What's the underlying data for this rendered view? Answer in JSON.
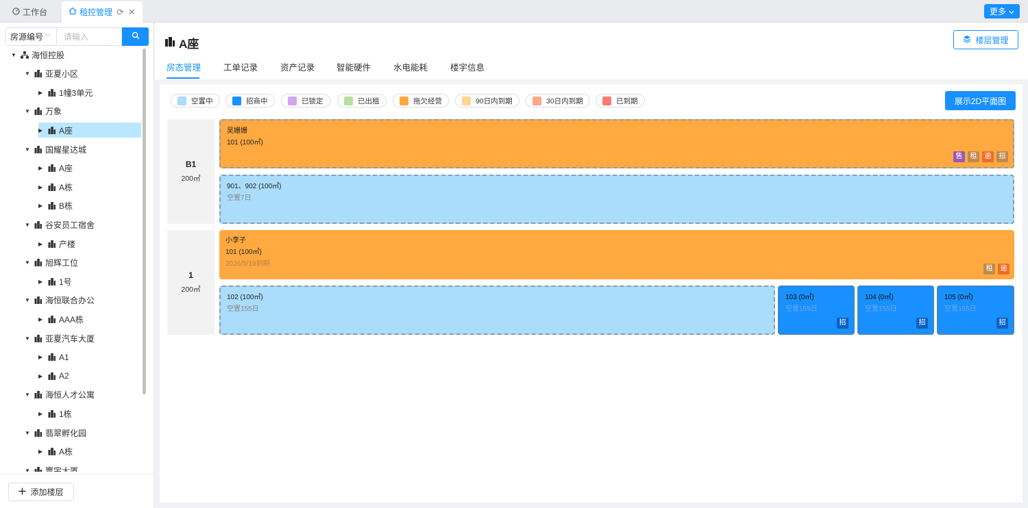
{
  "tabs_bar": {
    "workbench": "工作台",
    "rent_control": "租控管理",
    "more": "更多"
  },
  "sidebar": {
    "search_select": "房源编号",
    "search_placeholder": "请输入",
    "tree": [
      {
        "label": "海恒控股",
        "level": 0,
        "expanded": true,
        "icon": "org-icon"
      },
      {
        "label": "亚夏小区",
        "level": 1,
        "expanded": true,
        "icon": "building-icon"
      },
      {
        "label": "1幢3单元",
        "level": 2,
        "expanded": false,
        "icon": "building-icon"
      },
      {
        "label": "万象",
        "level": 1,
        "expanded": true,
        "icon": "building-icon"
      },
      {
        "label": "A座",
        "level": 2,
        "expanded": false,
        "icon": "building-icon",
        "selected": true
      },
      {
        "label": "国耀星达城",
        "level": 1,
        "expanded": true,
        "icon": "building-icon"
      },
      {
        "label": "A座",
        "level": 2,
        "expanded": false,
        "icon": "building-icon"
      },
      {
        "label": "A栋",
        "level": 2,
        "expanded": false,
        "icon": "building-icon"
      },
      {
        "label": "B栋",
        "level": 2,
        "expanded": false,
        "icon": "building-icon"
      },
      {
        "label": "谷安员工宿舍",
        "level": 1,
        "expanded": true,
        "icon": "building-icon"
      },
      {
        "label": "产楼",
        "level": 2,
        "expanded": false,
        "icon": "building-icon"
      },
      {
        "label": "旭辉工位",
        "level": 1,
        "expanded": true,
        "icon": "building-icon"
      },
      {
        "label": "1号",
        "level": 2,
        "expanded": false,
        "icon": "building-icon"
      },
      {
        "label": "海恒联合办公",
        "level": 1,
        "expanded": true,
        "icon": "building-icon"
      },
      {
        "label": "AAA栋",
        "level": 2,
        "expanded": false,
        "icon": "building-icon"
      },
      {
        "label": "亚夏汽车大厦",
        "level": 1,
        "expanded": true,
        "icon": "building-icon"
      },
      {
        "label": "A1",
        "level": 2,
        "expanded": false,
        "icon": "building-icon"
      },
      {
        "label": "A2",
        "level": 2,
        "expanded": false,
        "icon": "building-icon"
      },
      {
        "label": "海恒人才公寓",
        "level": 1,
        "expanded": true,
        "icon": "building-icon"
      },
      {
        "label": "1栋",
        "level": 2,
        "expanded": false,
        "icon": "building-icon"
      },
      {
        "label": "翡翠孵化园",
        "level": 1,
        "expanded": true,
        "icon": "building-icon"
      },
      {
        "label": "A栋",
        "level": 2,
        "expanded": false,
        "icon": "building-icon"
      },
      {
        "label": "寰宇大厦",
        "level": 1,
        "expanded": true,
        "icon": "building-icon"
      }
    ],
    "add_floor": "添加楼层"
  },
  "header": {
    "title": "A座",
    "floor_manage": "楼层管理",
    "tabs": [
      "房态管理",
      "工单记录",
      "资产记录",
      "智能硬件",
      "水电能耗",
      "楼宇信息"
    ]
  },
  "legend": [
    {
      "label": "空置中",
      "color": "#aadcfb"
    },
    {
      "label": "招商中",
      "color": "#1890ff"
    },
    {
      "label": "已锁定",
      "color": "#d3a4f0"
    },
    {
      "label": "已出租",
      "color": "#b7e0a0"
    },
    {
      "label": "拖欠经营",
      "color": "#ffa940"
    },
    {
      "label": "90日内到期",
      "color": "#ffd591"
    },
    {
      "label": "30日内到期",
      "color": "#ffa88a"
    },
    {
      "label": "已到期",
      "color": "#ff7875"
    }
  ],
  "show_2d": "展示2D平面图",
  "floors": [
    {
      "name": "B1",
      "area": "200㎡",
      "units": [
        {
          "line1": "吴姗姗",
          "line2": "101 (100㎡)",
          "line3": "",
          "badges": [
            "售",
            "租",
            "逾",
            "招"
          ]
        },
        {
          "line1": "901、902 (100㎡)",
          "line2": "空置7日",
          "badges": []
        }
      ]
    },
    {
      "name": "1",
      "area": "200㎡",
      "units": [
        {
          "line1": "小李子",
          "line2": "101 (100㎡)",
          "line3": "2026/5/19到期",
          "badges": [
            "租",
            "逾"
          ]
        },
        {
          "line1": "102 (100㎡)",
          "line2": "空置155日",
          "badges": []
        },
        {
          "line1": "103 (0㎡)",
          "line2": "空置155日",
          "badges": [
            "招"
          ]
        },
        {
          "line1": "104 (0㎡)",
          "line2": "空置155日",
          "badges": [
            "招"
          ]
        },
        {
          "line1": "105 (0㎡)",
          "line2": "空置155日",
          "badges": [
            "招"
          ]
        }
      ]
    }
  ],
  "badge_colors": {
    "售": "#9b59b6",
    "租": "#c08a4f",
    "逾": "#f06c2a",
    "招": "#c08a4f",
    "招-blue": "#0b62c4"
  }
}
